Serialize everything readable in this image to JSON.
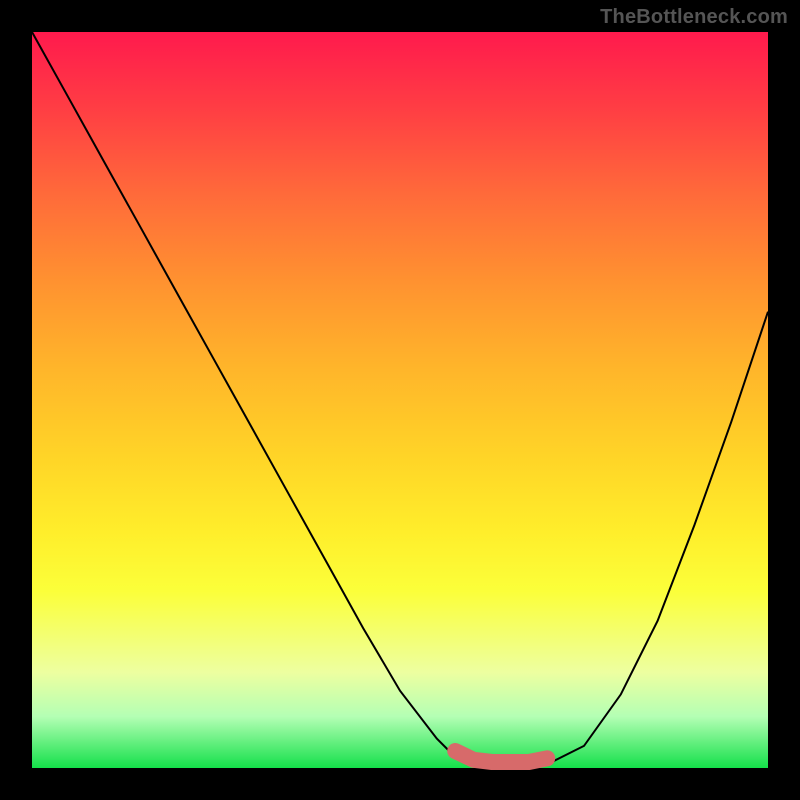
{
  "attribution": "TheBottleneck.com",
  "colors": {
    "frame": "#000000",
    "gradient_top": "#ff1a4d",
    "gradient_mid": "#ffd527",
    "gradient_bottom": "#14e04a",
    "curve": "#000000",
    "emphasis": "#d76a6a"
  },
  "chart_data": {
    "type": "line",
    "title": "",
    "xlabel": "",
    "ylabel": "",
    "x": [
      0.0,
      0.05,
      0.1,
      0.15,
      0.2,
      0.25,
      0.3,
      0.35,
      0.4,
      0.45,
      0.5,
      0.55,
      0.575,
      0.6,
      0.625,
      0.65,
      0.675,
      0.7,
      0.75,
      0.8,
      0.85,
      0.9,
      0.95,
      1.0
    ],
    "y": [
      1.0,
      0.91,
      0.82,
      0.73,
      0.64,
      0.55,
      0.46,
      0.37,
      0.28,
      0.19,
      0.105,
      0.04,
      0.015,
      0.003,
      0.0,
      0.0,
      0.0,
      0.005,
      0.03,
      0.1,
      0.2,
      0.33,
      0.47,
      0.62
    ],
    "xlim": [
      0,
      1
    ],
    "ylim": [
      0,
      1
    ],
    "emphasis_range_x": [
      0.56,
      0.7
    ],
    "notes": "Black curve on rainbow gradient; salmon overlay marks the flat minimum region between x≈0.56 and x≈0.70."
  }
}
